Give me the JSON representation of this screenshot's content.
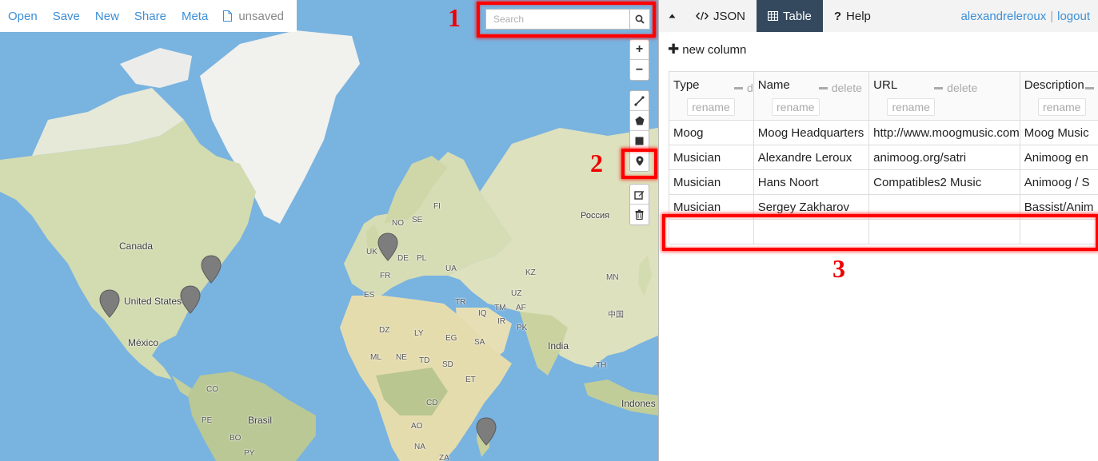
{
  "filebar": {
    "open": "Open",
    "save": "Save",
    "new": "New",
    "share": "Share",
    "meta": "Meta",
    "status": "unsaved"
  },
  "search": {
    "placeholder": "Search",
    "value": ""
  },
  "map": {
    "labels": {
      "canada": "Canada",
      "united_states": "United States",
      "mexico": "México",
      "brasil": "Brasil",
      "india": "India",
      "russia": "Россия",
      "indonesia": "Indones",
      "china": "中国",
      "uk": "UK",
      "de": "DE",
      "pl": "PL",
      "ua": "UA",
      "fr": "FR",
      "es": "ES",
      "tr": "TR",
      "iq": "IQ",
      "ir": "IR",
      "kz": "KZ",
      "mn": "MN",
      "sa": "SA",
      "eg": "EG",
      "ly": "LY",
      "dz": "DZ",
      "ml": "ML",
      "ne": "NE",
      "td": "TD",
      "sd": "SD",
      "et": "ET",
      "cd": "CD",
      "ao": "AO",
      "na": "NA",
      "za": "ZA",
      "co": "CO",
      "pe": "PE",
      "bo": "BO",
      "py": "PY",
      "se": "SE",
      "fi": "FI",
      "no": "NO",
      "th": "TH",
      "af": "AF",
      "pk": "PK",
      "uz": "UZ",
      "tm": "TM"
    },
    "markers": [
      "North America West",
      "North America East",
      "Canada East",
      "Europe",
      "Africa"
    ]
  },
  "panel": {
    "tabs": {
      "json": "JSON",
      "table": "Table",
      "help": "Help"
    },
    "user": "alexandreleroux",
    "logout": "logout",
    "new_column": "new column",
    "delete_label": "delete",
    "rename_label": "rename",
    "columns": [
      "Type",
      "Name",
      "URL",
      "Description"
    ],
    "rows": [
      [
        "Moog",
        "Moog Headquarters",
        "http://www.moogmusic.com",
        "Moog Music"
      ],
      [
        "Musician",
        "Alexandre Leroux",
        "animoog.org/satri",
        "Animoog en"
      ],
      [
        "Musician",
        "Hans Noort",
        "Compatibles2 Music",
        "Animoog / S"
      ],
      [
        "Musician",
        "Sergey Zakharov",
        "",
        "Bassist/Anim"
      ],
      [
        "",
        "",
        "",
        ""
      ]
    ]
  },
  "annotations": {
    "one": "1",
    "two": "2",
    "three": "3"
  },
  "colors": {
    "annotation_red": "#ff0000",
    "link_blue": "#3c8fd6",
    "active_tab": "#34495e",
    "water": "#79b3e0",
    "land": "#d4dcb2"
  }
}
